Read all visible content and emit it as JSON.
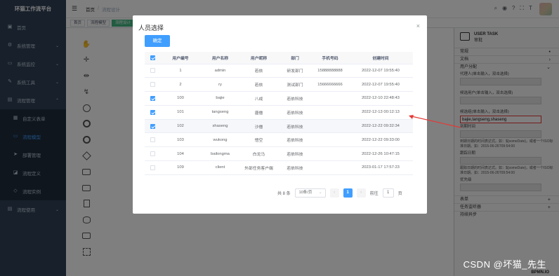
{
  "sidebar": {
    "title": "环猫工作流平台",
    "items": [
      {
        "label": "首页",
        "icon": "dashboard-icon"
      },
      {
        "label": "系统管理",
        "icon": "gear-icon"
      },
      {
        "label": "系统监控",
        "icon": "monitor-icon"
      },
      {
        "label": "系统工具",
        "icon": "tool-icon"
      },
      {
        "label": "流程管理",
        "icon": "flow-icon"
      },
      {
        "label": "自定义表单",
        "icon": "form-icon"
      },
      {
        "label": "流程模型",
        "icon": "model-icon"
      },
      {
        "label": "部署管理",
        "icon": "send-icon"
      },
      {
        "label": "流程定义",
        "icon": "definition-icon"
      },
      {
        "label": "流程实例 ",
        "icon": "instance-icon"
      },
      {
        "label": "流程使用",
        "icon": "use-icon"
      }
    ]
  },
  "topbar": {
    "crumb_home": "首页",
    "crumb_current": "流程设计"
  },
  "tags": [
    "首页",
    "流程模型",
    "流程设计"
  ],
  "properties": {
    "head_title": "USER TASK",
    "head_sub": "审批",
    "sections": [
      "常规",
      "文档",
      "用户分配"
    ],
    "assignee_label": "代理人(单击输入，双击选择)",
    "candidate_user_label": "候选用户(单击输入，双击选择)",
    "candidate_group_label": "候选组(单击输入，双击选择)",
    "candidate_group_value": "bajie,tangseng,shaseng",
    "due_date_label": "到期时间",
    "due_date_desc": "到期日期的时间表达式。如：${someDate}，或者一个ISO标准日期。如：2015-06-26T09:54:00",
    "follow_up_label": "跟踪日期",
    "follow_up_desc": "跟踪日期的时间表达式。如：${someDate}，或者一个ISO标准日期。如：2015-06-26T09:54:00",
    "priority_label": "优先级",
    "bottom_sections": [
      "表单",
      "任务监听器",
      "持续异步"
    ],
    "bpmn_logo": "BPMN.IO"
  },
  "dialog": {
    "title": "人员选择",
    "confirm_label": "确定",
    "columns": [
      "用户编号",
      "用户名称",
      "用户昵称",
      "部门",
      "手机号码",
      "创建时间"
    ],
    "rows": [
      {
        "checked": false,
        "id": "1",
        "name": "admin",
        "nick": "若依",
        "dept": "研发部门",
        "phone": "15888888888",
        "created": "2022-12-07 19:55:40"
      },
      {
        "checked": false,
        "id": "2",
        "name": "ry",
        "nick": "若依",
        "dept": "测试部门",
        "phone": "15666666666",
        "created": "2022-12-07 19:55:40"
      },
      {
        "checked": true,
        "id": "100",
        "name": "bajie",
        "nick": "八戒",
        "dept": "若依科技",
        "phone": "",
        "created": "2022-12-10 22:48:43"
      },
      {
        "checked": true,
        "id": "101",
        "name": "tangseng",
        "nick": "唐僧",
        "dept": "若依科技",
        "phone": "",
        "created": "2022-12-13 00:12:13"
      },
      {
        "checked": true,
        "id": "102",
        "name": "shaseng",
        "nick": "沙僧",
        "dept": "若依科技",
        "phone": "",
        "created": "2022-12-22 09:32:34"
      },
      {
        "checked": false,
        "id": "103",
        "name": "wukong",
        "nick": "悟空",
        "dept": "若依科技",
        "phone": "",
        "created": "2022-12-22 09:33:00"
      },
      {
        "checked": false,
        "id": "104",
        "name": "bailongma",
        "nick": "白龙马",
        "dept": "若依科技",
        "phone": "",
        "created": "2022-12-26 10:47:15"
      },
      {
        "checked": false,
        "id": "109",
        "name": "client",
        "nick": "外部任务客户端",
        "dept": "若依科技",
        "phone": "",
        "created": "2023-01-17 17:57:23"
      }
    ],
    "pagination": {
      "total": "共 8 条",
      "page_size": "10条/页",
      "current_page": "1",
      "goto_prefix": "前往",
      "goto_value": "1",
      "goto_suffix": "页"
    }
  },
  "watermark": "CSDN @坏猫_先生"
}
